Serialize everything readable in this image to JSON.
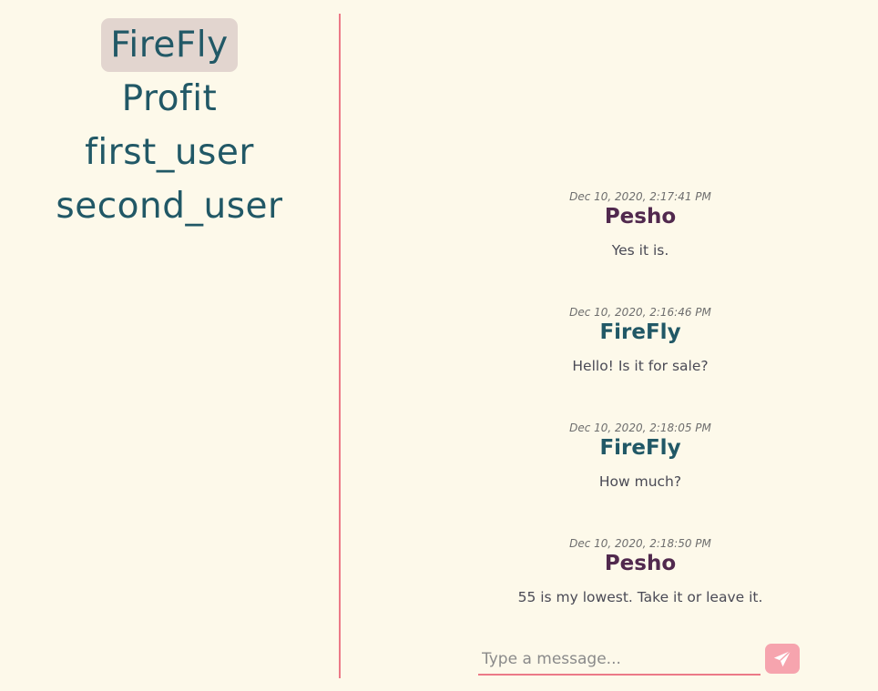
{
  "sidebar": {
    "contacts": [
      {
        "name": "FireFly",
        "active": true
      },
      {
        "name": "Profit",
        "active": false
      },
      {
        "name": "first_user",
        "active": false
      },
      {
        "name": "second_user",
        "active": false
      }
    ]
  },
  "chat": {
    "messages": [
      {
        "timestamp": "Dec 10, 2020, 2:17:41 PM",
        "author": "Pesho",
        "text": "Yes it is."
      },
      {
        "timestamp": "Dec 10, 2020, 2:16:46 PM",
        "author": "FireFly",
        "text": "Hello! Is it for sale?"
      },
      {
        "timestamp": "Dec 10, 2020, 2:18:05 PM",
        "author": "FireFly",
        "text": "How much?"
      },
      {
        "timestamp": "Dec 10, 2020, 2:18:50 PM",
        "author": "Pesho",
        "text": "55 is my lowest. Take it or leave it."
      }
    ]
  },
  "composer": {
    "placeholder": "Type a message...",
    "value": "",
    "send_icon": "paper-plane-icon"
  },
  "colors": {
    "background": "#fdf9ea",
    "accent": "#ec7a87",
    "contact_text": "#215866",
    "active_pill": "#e2d5cf",
    "pesho": "#51294e",
    "firefly": "#215866",
    "send_button": "#f6a4ae"
  }
}
